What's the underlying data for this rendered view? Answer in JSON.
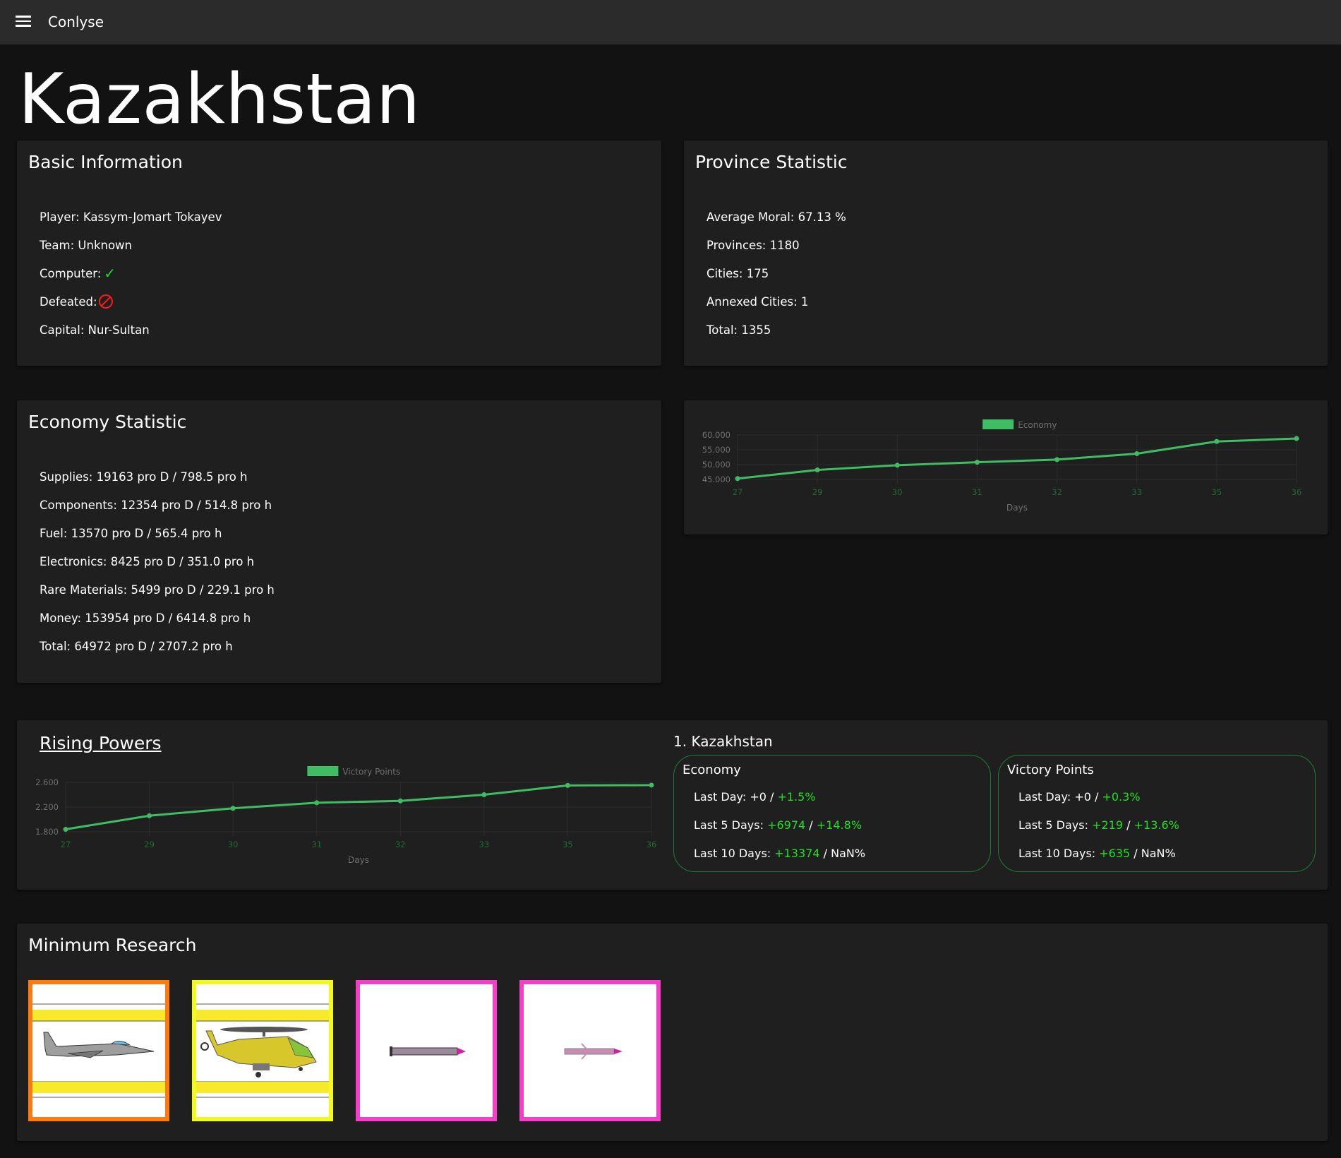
{
  "app": {
    "title": "Conlyse"
  },
  "country": {
    "name": "Kazakhstan"
  },
  "basic_info": {
    "title": "Basic Information",
    "player": "Player: Kassym-Jomart Tokayev",
    "team": "Team: Unknown",
    "computer_label": "Computer:",
    "computer_value": "✓",
    "defeated_label": "Defeated:",
    "capital": "Capital: Nur-Sultan"
  },
  "province_stats": {
    "title": "Province Statistic",
    "average_moral": "Average Moral: 67.13 %",
    "provinces": "Provinces: 1180",
    "cities": "Cities: 175",
    "annexed_cities": "Annexed Cities: 1",
    "total": "Total: 1355"
  },
  "economy_stats": {
    "title": "Economy Statistic",
    "rows": [
      "Supplies: 19163 pro D / 798.5 pro h",
      "Components: 12354 pro D / 514.8 pro h",
      "Fuel: 13570 pro D / 565.4 pro h",
      "Electronics: 8425 pro D / 351.0 pro h",
      "Rare Materials: 5499 pro D / 229.1 pro h",
      "Money: 153954 pro D / 6414.8 pro h",
      "Total: 64972 pro D / 2707.2 pro h"
    ]
  },
  "rising_powers": {
    "title": "Rising Powers",
    "rank_title": "1. Kazakhstan",
    "economy_box": {
      "title": "Economy",
      "last_day_label": "Last Day: +0 / ",
      "last_day_pct": "+1.5%",
      "last5_label": "Last 5 Days: ",
      "last5_value": "+6974",
      "last5_sep": " / ",
      "last5_pct": "+14.8%",
      "last10_label": "Last 10 Days: ",
      "last10_value": "+13374",
      "last10_rest": " / NaN%"
    },
    "vp_box": {
      "title": "Victory Points",
      "last_day_label": "Last Day: +0 / ",
      "last_day_pct": "+0.3%",
      "last5_label": "Last 5 Days: ",
      "last5_value": "+219",
      "last5_sep": " / ",
      "last5_pct": "+13.6%",
      "last10_label": "Last 10 Days: ",
      "last10_value": "+635",
      "last10_rest": " / NaN%"
    }
  },
  "research": {
    "title": "Minimum Research",
    "items": [
      {
        "name": "fighter-jet",
        "border": "#ff7b0f"
      },
      {
        "name": "attack-helicopter",
        "border": "#f2f91c"
      },
      {
        "name": "cruise-missile",
        "border": "#f53fc9"
      },
      {
        "name": "anti-air-missile",
        "border": "#f53fc9"
      }
    ]
  },
  "colors": {
    "line_green": "#3fbd63",
    "legend_green": "#3fbd63",
    "box_border": "#1e7a3c"
  },
  "chart_data": [
    {
      "type": "line",
      "title": "",
      "legend": "Economy",
      "xlabel": "Days",
      "ylabel": "",
      "categories": [
        "27",
        "29",
        "30",
        "31",
        "32",
        "33",
        "35",
        "36"
      ],
      "y_ticks": [
        "60.000",
        "55.000",
        "50.000",
        "45.000"
      ],
      "ylim": [
        45000,
        60000
      ],
      "series": [
        {
          "name": "Economy",
          "values": [
            45300,
            48200,
            49800,
            50800,
            51700,
            53700,
            57800,
            58800
          ]
        }
      ]
    },
    {
      "type": "line",
      "title": "",
      "legend": "Victory Points",
      "xlabel": "Days",
      "ylabel": "",
      "categories": [
        "27",
        "29",
        "30",
        "31",
        "32",
        "33",
        "35",
        "36"
      ],
      "y_ticks": [
        "2.600",
        "2.200",
        "1.800"
      ],
      "ylim": [
        1800,
        2600
      ],
      "series": [
        {
          "name": "Victory Points",
          "values": [
            1840,
            2060,
            2180,
            2270,
            2300,
            2400,
            2550,
            2555
          ]
        }
      ]
    }
  ]
}
